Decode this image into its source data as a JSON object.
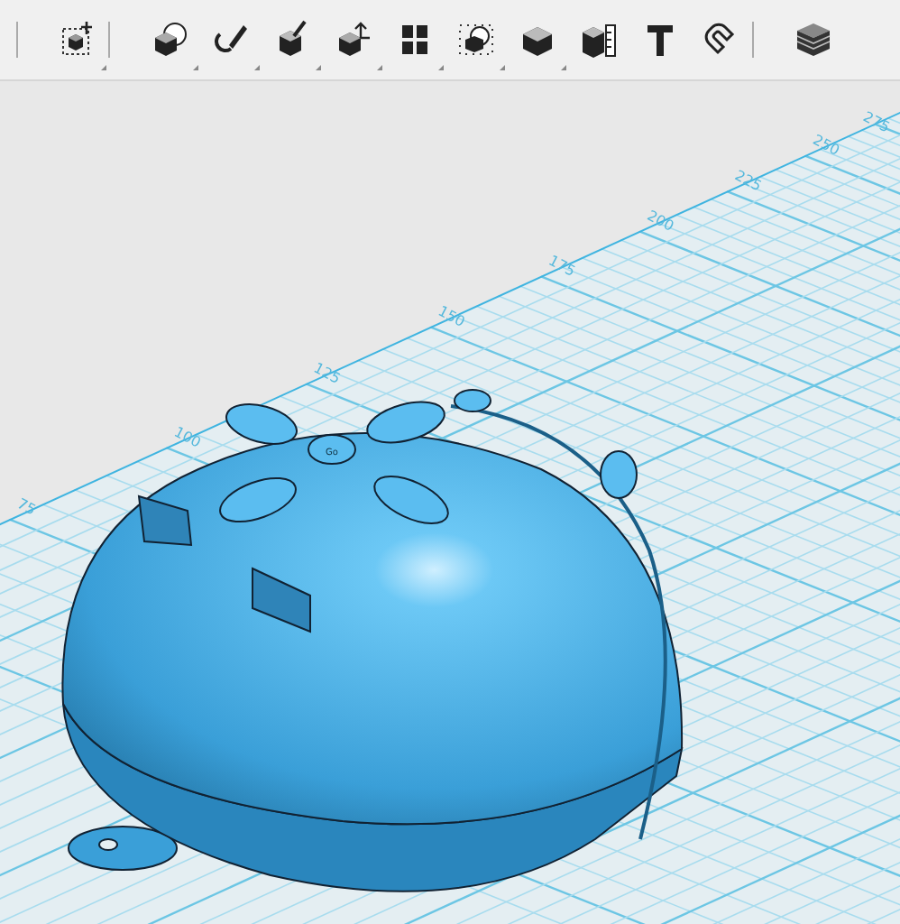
{
  "toolbar": {
    "items": [
      {
        "kind": "separator"
      },
      {
        "kind": "transform",
        "has_menu": true
      },
      {
        "kind": "separator"
      },
      {
        "kind": "primitives",
        "has_menu": true
      },
      {
        "kind": "sketch",
        "has_menu": true
      },
      {
        "kind": "construct",
        "has_menu": true
      },
      {
        "kind": "modify",
        "has_menu": true
      },
      {
        "kind": "pattern",
        "has_menu": true
      },
      {
        "kind": "grouping",
        "has_menu": true
      },
      {
        "kind": "combine",
        "has_menu": true
      },
      {
        "kind": "measure",
        "has_menu": false
      },
      {
        "kind": "text",
        "has_menu": false
      },
      {
        "kind": "snap",
        "has_menu": false
      },
      {
        "kind": "separator"
      },
      {
        "kind": "materials",
        "has_menu": false
      }
    ]
  },
  "viewport": {
    "axis_labels": [
      "75",
      "100",
      "125",
      "150",
      "175",
      "200",
      "225",
      "250",
      "275"
    ],
    "model_label": "Go"
  }
}
